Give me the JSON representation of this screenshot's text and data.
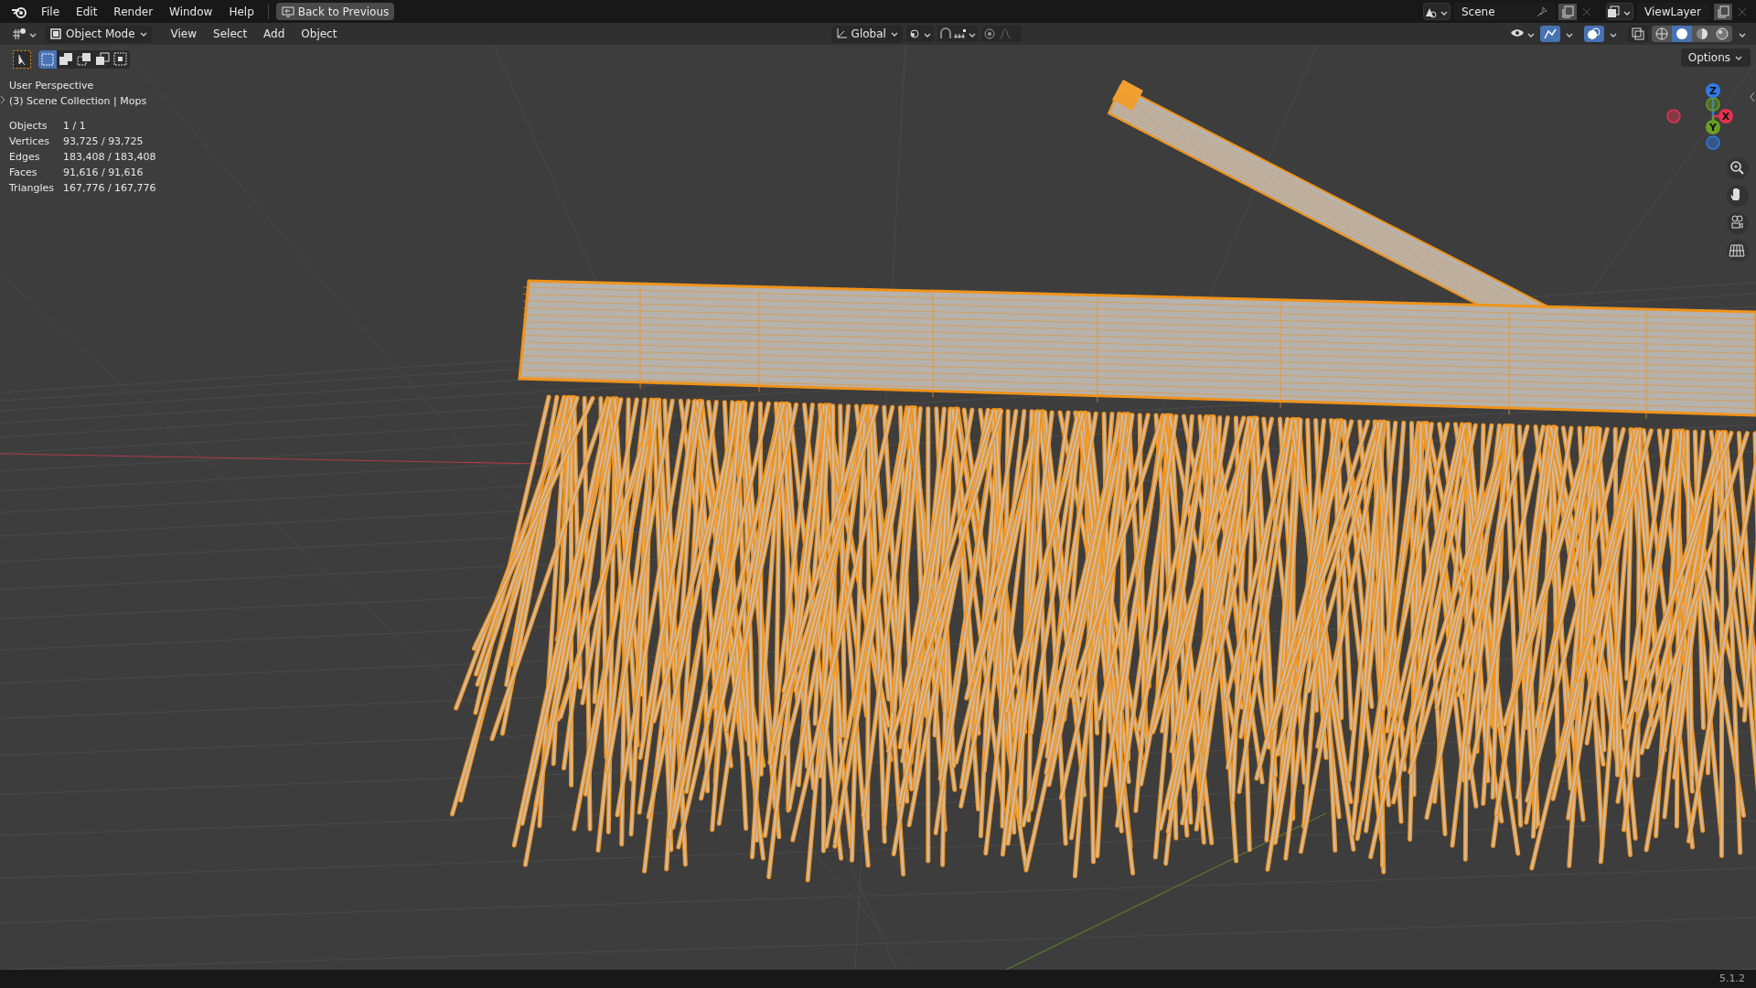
{
  "top_bar": {
    "menus": [
      "File",
      "Edit",
      "Render",
      "Window",
      "Help"
    ],
    "back_button": "Back to Previous",
    "scene": "Scene",
    "view_layer": "ViewLayer"
  },
  "header": {
    "mode": "Object Mode",
    "menus": [
      "View",
      "Select",
      "Add",
      "Object"
    ],
    "orientation": "Global",
    "shading_modes": [
      {
        "selected": false
      },
      {
        "selected": true
      },
      {
        "selected": false
      },
      {
        "selected": false
      }
    ]
  },
  "toolbar": {
    "select_modes": [
      {
        "selected": true
      },
      {
        "selected": false
      },
      {
        "selected": false
      },
      {
        "selected": false
      },
      {
        "selected": false
      }
    ]
  },
  "viewport": {
    "options_button": "Options",
    "perspective": "User Perspective",
    "collection": "(3) Scene Collection | Mops",
    "stats": [
      {
        "label": "Objects",
        "value": "1 / 1"
      },
      {
        "label": "Vertices",
        "value": "93,725 / 93,725"
      },
      {
        "label": "Edges",
        "value": "183,408 / 183,408"
      },
      {
        "label": "Faces",
        "value": "91,616 / 91,616"
      },
      {
        "label": "Triangles",
        "value": "167,776 / 167,776"
      }
    ],
    "gizmo_axes": [
      {
        "label": "Z",
        "color": "#2f7ae5"
      },
      {
        "label": "X",
        "color": "#e5334f"
      },
      {
        "label": "Y",
        "color": "#6a9e23"
      }
    ]
  },
  "status_bar": {
    "version": "5.1.2"
  }
}
